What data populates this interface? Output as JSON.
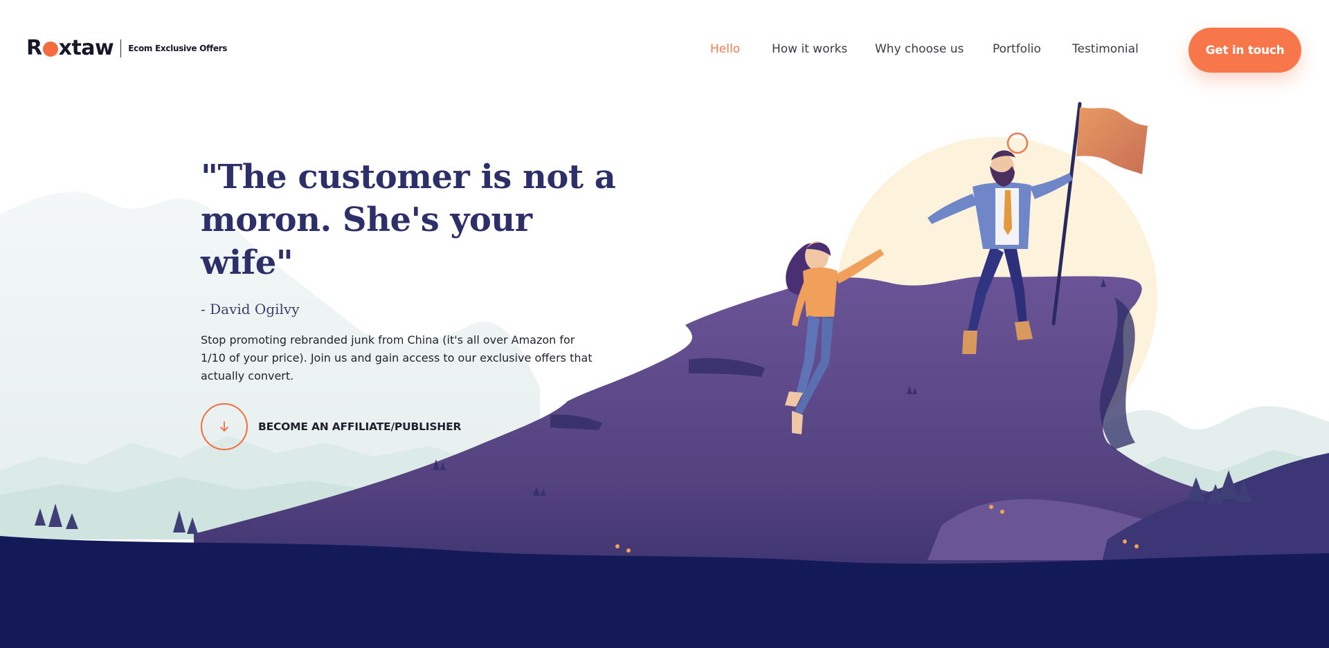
{
  "brand": {
    "logo_prefix": "R",
    "logo_suffix": "xtaw",
    "tagline": "Ecom Exclusive Offers"
  },
  "nav": {
    "items": [
      {
        "label": "Hello",
        "active": true
      },
      {
        "label": "How it works",
        "active": false
      },
      {
        "label": "Why choose us",
        "active": false
      },
      {
        "label": "Portfolio",
        "active": false
      },
      {
        "label": "Testimonial",
        "active": false
      }
    ],
    "cta_label": "Get in touch"
  },
  "hero": {
    "quote": "\"The customer is not a moron. She's your wife\"",
    "author": "- David Ogilvy",
    "description": "Stop promoting rebranded junk from China (it's all over Amazon for 1/10 of your price). Join us and gain access to our exclusive offers that actually convert.",
    "affiliate_label": "BECOME AN AFFILIATE/PUBLISHER",
    "affiliate_icon": "arrow-down-icon"
  },
  "colors": {
    "accent": "#f7774a",
    "heading": "#2d3068",
    "ground": "#141a57",
    "hill": "#5a4688",
    "sun": "#fdf2dc"
  }
}
